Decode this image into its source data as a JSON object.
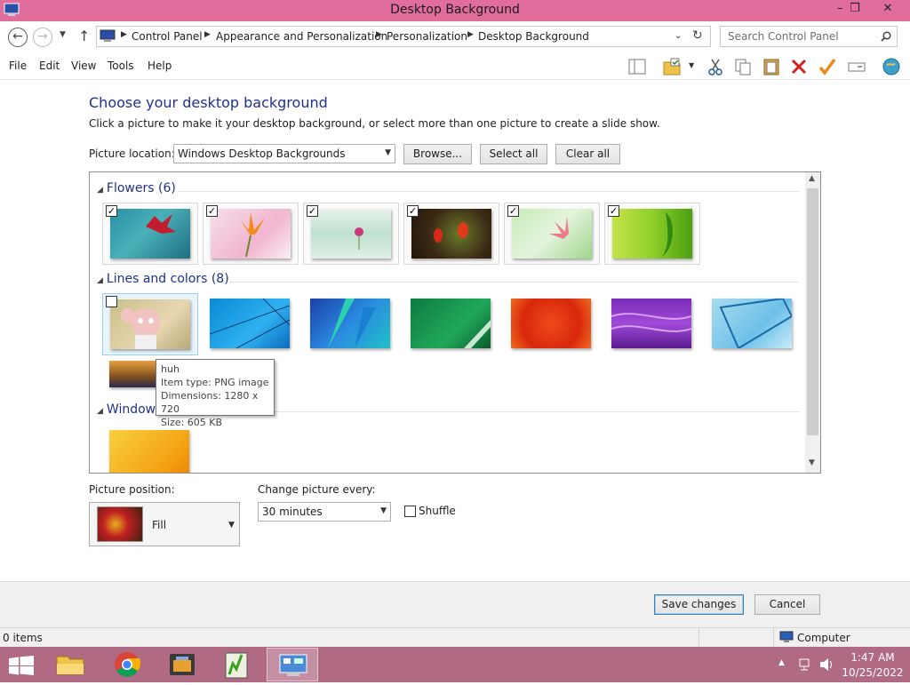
{
  "window": {
    "title": "Desktop Background",
    "minimize": "–",
    "maximize": "❒",
    "close": "✕"
  },
  "address": {
    "crumbs": [
      "Control Panel",
      "Appearance and Personalization",
      "Personalization",
      "Desktop Background"
    ],
    "search_placeholder": "Search Control Panel"
  },
  "menu": [
    "File",
    "Edit",
    "View",
    "Tools",
    "Help"
  ],
  "content": {
    "heading": "Choose your desktop background",
    "subheading": "Click a picture to make it your desktop background, or select more than one picture to create a slide show.",
    "picture_location_label": "Picture location:",
    "picture_location_value": "Windows Desktop Backgrounds",
    "browse": "Browse...",
    "select_all": "Select all",
    "clear_all": "Clear all"
  },
  "groups": [
    {
      "title": "Flowers (6)"
    },
    {
      "title": "Lines and colors (8)"
    },
    {
      "title": "Windows"
    }
  ],
  "tooltip": {
    "name": "huh",
    "type": "Item type: PNG image",
    "dimensions": "Dimensions: 1280 x 720",
    "size": "Size: 605 KB"
  },
  "position": {
    "label": "Picture position:",
    "value": "Fill"
  },
  "change": {
    "label": "Change picture every:",
    "value": "30 minutes",
    "shuffle": "Shuffle"
  },
  "footer": {
    "save": "Save changes",
    "cancel": "Cancel"
  },
  "status": {
    "items": "0 items",
    "computer": "Computer"
  },
  "clock": {
    "time": "1:47 AM",
    "date": "10/25/2022"
  },
  "colors": {
    "titlebar": "#e06d9c",
    "taskbar": "#b06a84",
    "heading": "#1e3287"
  }
}
